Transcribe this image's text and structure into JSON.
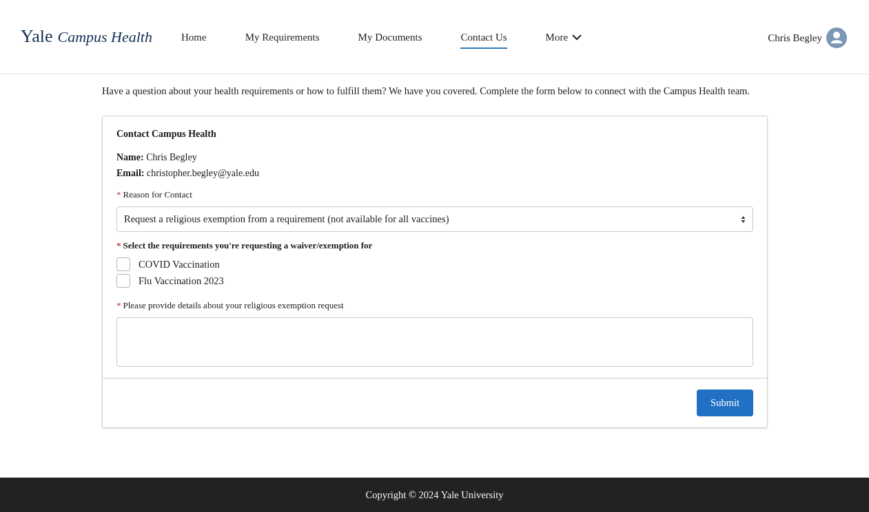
{
  "header": {
    "logo": {
      "brand": "Yale",
      "product": "Campus Health"
    },
    "nav": [
      {
        "label": "Home",
        "selected": false
      },
      {
        "label": "My Requirements",
        "selected": false
      },
      {
        "label": "My Documents",
        "selected": false
      },
      {
        "label": "Contact Us",
        "selected": true
      },
      {
        "label": "More",
        "selected": false,
        "kind": "dropdown"
      }
    ],
    "user": {
      "name": "Chris Begley"
    }
  },
  "intro": "Have a question about your health requirements or how to fulfill them? We have you covered. Complete the form below to connect with the Campus Health team.",
  "form": {
    "title": "Contact Campus Health",
    "info": [
      "**Name:** Chris Begley",
      "**Email:** christopher.begley@yale.edu"
    ],
    "reason": {
      "required_mark": "*",
      "label": "Reason for Contact",
      "value": "Request a religious exemption from a requirement (not available for all vaccines)"
    },
    "requirements": {
      "required_mark": "*",
      "label": "Select the requirements you're requesting a waiver/exemption for",
      "options": [
        {
          "label": "COVID Vaccination",
          "checked": false
        },
        {
          "label": "Flu Vaccination 2023",
          "checked": false
        }
      ]
    },
    "details": {
      "required_mark": "*",
      "label": "Please provide details about your religious exemption request"
    },
    "submit": "Submit"
  },
  "footer": "Copyright © 2024 Yale University"
}
